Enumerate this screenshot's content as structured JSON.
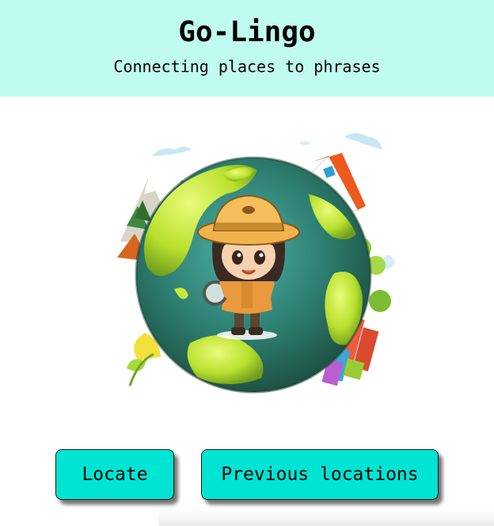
{
  "header": {
    "title": "Go-Lingo",
    "subtitle": "Connecting places to phrases"
  },
  "hero": {
    "image": "explorer-girl-on-globe-illustration"
  },
  "actions": {
    "locate_label": "Locate",
    "previous_label": "Previous locations"
  },
  "colors": {
    "header_bg": "#c0fbef",
    "button_bg": "#00e4d4"
  }
}
